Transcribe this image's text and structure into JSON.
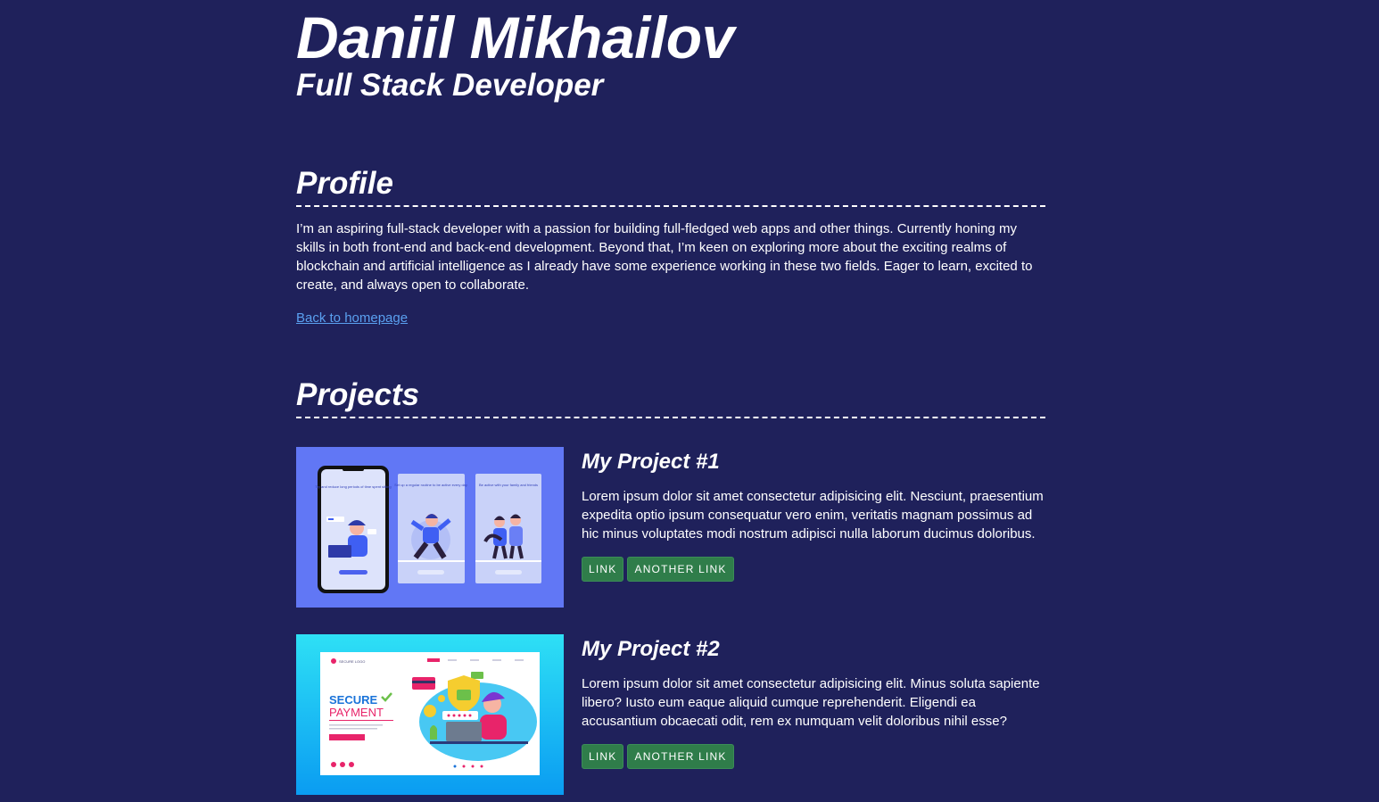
{
  "header": {
    "name": "Daniil Mikhailov",
    "role": "Full Stack Developer"
  },
  "profile": {
    "title": "Profile",
    "text": "I’m an aspiring full-stack developer with a passion for building full-fledged web apps and other things. Currently honing my skills in both front-end and back-end development. Beyond that, I’m keen on exploring more about the exciting realms of blockchain and artificial intelligence as I already have some experience working in these two fields. Eager to learn, excited to create, and always open to collaborate.",
    "back_link": "Back to homepage"
  },
  "projects": {
    "title": "Projects",
    "items": [
      {
        "title": "My Project #1",
        "description": "Lorem ipsum dolor sit amet consectetur adipisicing elit. Nesciunt, praesentium expedita optio ipsum consequatur vero enim, veritatis magnam possimus ad hic minus voluptates modi nostrum adipisci nulla laborum ducimus doloribus.",
        "link_label": "Link",
        "another_link_label": "Another link",
        "image": {
          "screen_1_text": "Try and reduce long periods of time spent sitting",
          "screen_2_text": "Set up a regular routine to be active every day",
          "screen_3_text": "Be active with your family and friends"
        }
      },
      {
        "title": "My Project #2",
        "description": "Lorem ipsum dolor sit amet consectetur adipisicing elit. Minus soluta sapiente libero? Iusto eum eaque aliquid cumque reprehenderit. Eligendi ea accusantium obcaecati odit, rem ex numquam velit doloribus nihil esse?",
        "link_label": "Link",
        "another_link_label": "Another link",
        "image": {
          "logo_text": "SECURE LOGO",
          "headline_1": "SECURE",
          "headline_2": "PAYMENT"
        }
      }
    ]
  },
  "colors": {
    "background": "#1f215b",
    "text": "#ffffff",
    "link": "#5aa0f0",
    "button": "#2f7d4a"
  }
}
